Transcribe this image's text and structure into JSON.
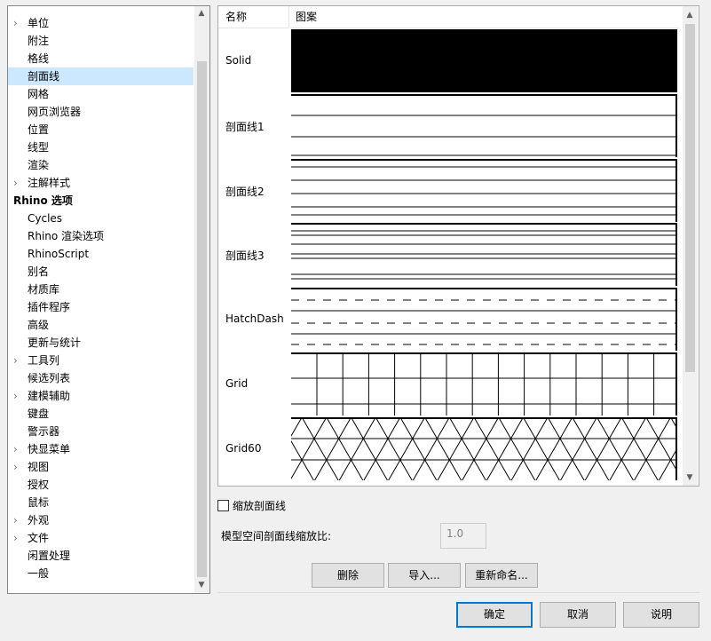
{
  "tree": {
    "items": [
      {
        "label": "单位",
        "indent": 1,
        "expandable": true
      },
      {
        "label": "附注",
        "indent": 1,
        "expandable": false
      },
      {
        "label": "格线",
        "indent": 1,
        "expandable": false
      },
      {
        "label": "剖面线",
        "indent": 1,
        "expandable": false,
        "selected": true
      },
      {
        "label": "网格",
        "indent": 1,
        "expandable": false
      },
      {
        "label": "网页浏览器",
        "indent": 1,
        "expandable": false
      },
      {
        "label": "位置",
        "indent": 1,
        "expandable": false
      },
      {
        "label": "线型",
        "indent": 1,
        "expandable": false
      },
      {
        "label": "渲染",
        "indent": 1,
        "expandable": false
      },
      {
        "label": "注解样式",
        "indent": 1,
        "expandable": true
      },
      {
        "label": "Rhino 选项",
        "indent": 0,
        "expandable": false,
        "bold": true
      },
      {
        "label": "Cycles",
        "indent": 1,
        "expandable": false
      },
      {
        "label": "Rhino 渲染选项",
        "indent": 1,
        "expandable": false
      },
      {
        "label": "RhinoScript",
        "indent": 1,
        "expandable": false
      },
      {
        "label": "别名",
        "indent": 1,
        "expandable": false
      },
      {
        "label": "材质库",
        "indent": 1,
        "expandable": false
      },
      {
        "label": "插件程序",
        "indent": 1,
        "expandable": false
      },
      {
        "label": "高级",
        "indent": 1,
        "expandable": false
      },
      {
        "label": "更新与统计",
        "indent": 1,
        "expandable": false
      },
      {
        "label": "工具列",
        "indent": 1,
        "expandable": true
      },
      {
        "label": "候选列表",
        "indent": 1,
        "expandable": false
      },
      {
        "label": "建模辅助",
        "indent": 1,
        "expandable": true
      },
      {
        "label": "键盘",
        "indent": 1,
        "expandable": false
      },
      {
        "label": "警示器",
        "indent": 1,
        "expandable": false
      },
      {
        "label": "快显菜单",
        "indent": 1,
        "expandable": true
      },
      {
        "label": "视图",
        "indent": 1,
        "expandable": true
      },
      {
        "label": "授权",
        "indent": 1,
        "expandable": false
      },
      {
        "label": "鼠标",
        "indent": 1,
        "expandable": false
      },
      {
        "label": "外观",
        "indent": 1,
        "expandable": true
      },
      {
        "label": "文件",
        "indent": 1,
        "expandable": true
      },
      {
        "label": "闲置处理",
        "indent": 1,
        "expandable": false
      },
      {
        "label": "一般",
        "indent": 1,
        "expandable": false
      }
    ]
  },
  "hatch_table": {
    "col_name": "名称",
    "col_pattern": "图案",
    "rows": [
      {
        "name": "Solid",
        "pattern": "solid"
      },
      {
        "name": "剖面线1",
        "pattern": "hatch1"
      },
      {
        "name": "剖面线2",
        "pattern": "hatch2"
      },
      {
        "name": "剖面线3",
        "pattern": "hatch3"
      },
      {
        "name": "HatchDash",
        "pattern": "dash"
      },
      {
        "name": "Grid",
        "pattern": "grid"
      },
      {
        "name": "Grid60",
        "pattern": "grid60"
      }
    ]
  },
  "scale_checkbox_label": "缩放剖面线",
  "scale_label": "模型空间剖面线缩放比:",
  "scale_value": "1.0",
  "buttons": {
    "delete": "删除",
    "import": "导入...",
    "rename": "重新命名...",
    "ok": "确定",
    "cancel": "取消",
    "help": "说明"
  }
}
